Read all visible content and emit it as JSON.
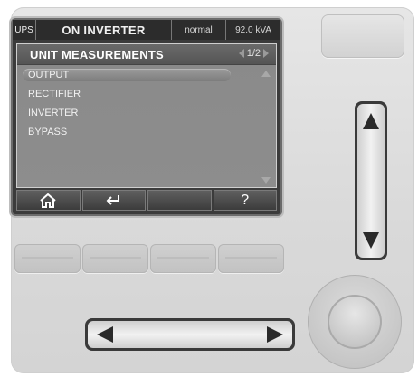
{
  "statusbar": {
    "device": "UPS",
    "state": "ON INVERTER",
    "mode": "normal",
    "power": "92.0 kVA"
  },
  "screen": {
    "title": "UNIT MEASUREMENTS",
    "page": "1/2",
    "menu": [
      {
        "label": "OUTPUT",
        "selected": true
      },
      {
        "label": "RECTIFIER",
        "selected": false
      },
      {
        "label": "INVERTER",
        "selected": false
      },
      {
        "label": "BYPASS",
        "selected": false
      }
    ]
  },
  "softkeys": {
    "home": "home-icon",
    "back": "return-icon",
    "blank": "",
    "help": "?"
  },
  "colors": {
    "screen_bg": "#3b3b3b",
    "panel_bg": "#d9d9d9",
    "rocker_dark": "#3a3a3a"
  }
}
